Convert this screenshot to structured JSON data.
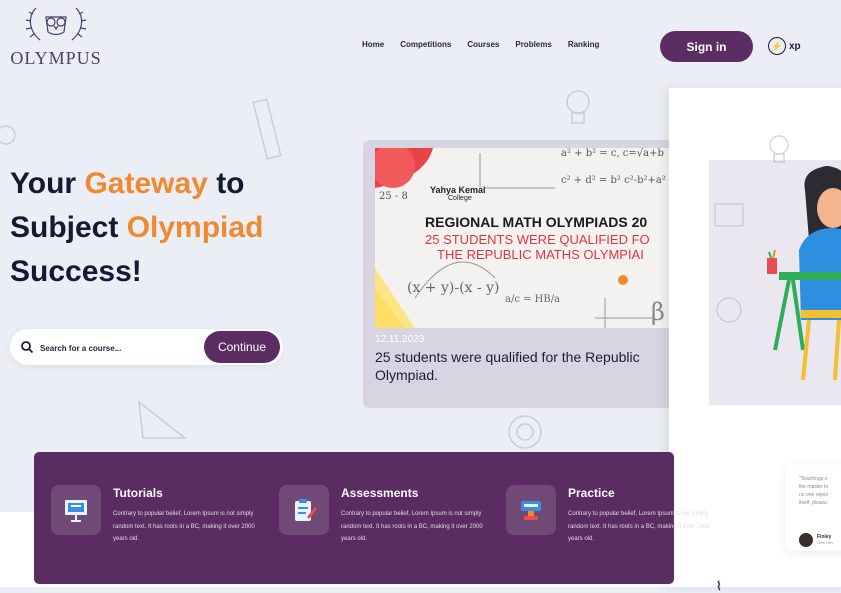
{
  "brand": {
    "name": "OLYMPUS",
    "logo_icon": "owl-laurel-icon"
  },
  "nav": {
    "items": [
      "Home",
      "Competitions",
      "Courses",
      "Problems",
      "Ranking"
    ]
  },
  "header": {
    "signin_label": "Sign in",
    "xp_label": "xp",
    "xp_icon": "lightning-icon"
  },
  "hero": {
    "line1_a": "Your ",
    "line1_accent": "Gateway",
    "line1_b": " to",
    "line2_a": "Subject ",
    "line2_accent": "Olympiad",
    "line3": "Success!"
  },
  "search": {
    "placeholder": "Search for a course...",
    "value": "",
    "button_label": "Continue"
  },
  "news": {
    "date": "12.11.2023",
    "title": "25 students were qualified for the Republic Olympiad.",
    "image": {
      "school": "Yahya Kemal",
      "school_sub": "College",
      "headline": "REGIONAL MATH OLYMPIADS 20",
      "sub_line1": "25 STUDENTS WERE QUALIFIED FO",
      "sub_line2": "THE REPUBLIC MATHS OLYMPIAI",
      "formula1": "a² + b² = c, c=√a+b",
      "formula2": "c² + d² = b² c²-b²+a²",
      "formula3": "(x + y)-(x - y)",
      "formula4": "a/c = HB/a",
      "num": "25 - 8"
    }
  },
  "testimonial": {
    "quote_lines": [
      "\"Teachings o",
      "the master to",
      "no one reject",
      "itself, pleasu"
    ],
    "name": "Finley",
    "role": "Web Dev"
  },
  "features": [
    {
      "title": "Tutorials",
      "icon": "presentation-board-icon",
      "desc": "Contrary to popular belief, Lorem Ipsum is not simply random text. It has roots in a BC, making it over 2000 years old."
    },
    {
      "title": "Assessments",
      "icon": "clipboard-edit-icon",
      "desc": "Contrary to popular belief, Lorem Ipsum is not simply random text. It has roots in a BC, making it over 2000 years old."
    },
    {
      "title": "Practice",
      "icon": "stamp-icon",
      "desc": "Contrary to popular belief, Lorem Ipsum is not simply random text. It has roots in a BC, making it over 2000 years old."
    }
  ],
  "colors": {
    "primary": "#5b2d62",
    "accent": "#f0892f",
    "background": "#eceef6",
    "heading": "#131a33"
  }
}
